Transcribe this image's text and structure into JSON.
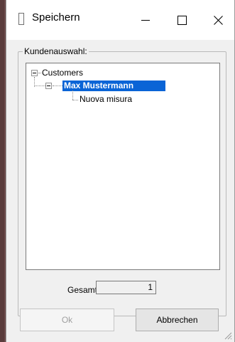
{
  "window": {
    "title": "Speichern"
  },
  "titlebar_buttons": {
    "minimize_icon": "minimize-icon",
    "maximize_icon": "maximize-icon",
    "close_icon": "close-icon"
  },
  "group": {
    "label": "Kundenauswahl:"
  },
  "tree": {
    "root": {
      "label": "Customers",
      "expanded": true
    },
    "customer": {
      "label": "Max Mustermann",
      "expanded": true,
      "selected": true
    },
    "measure": {
      "label": "Nuova misura"
    }
  },
  "total": {
    "label": "Gesamt:",
    "value": "1"
  },
  "buttons": {
    "ok": "Ok",
    "cancel": "Abbrechen"
  },
  "colors": {
    "selection": "#0a64d6",
    "dialog_bg": "#f0f0f0"
  }
}
